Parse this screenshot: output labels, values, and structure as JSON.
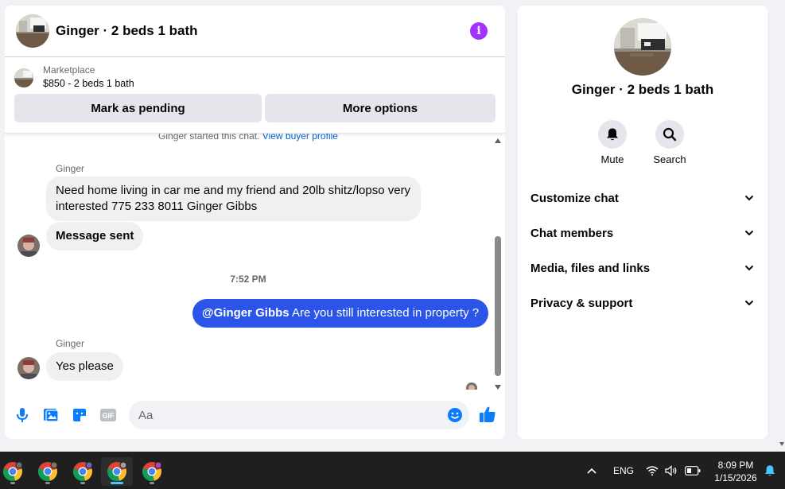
{
  "chat": {
    "title": "Ginger · 2 beds 1 bath",
    "listing": {
      "category": "Marketplace",
      "price_title": "$850 - 2 beds 1 bath",
      "mark_pending_label": "Mark as pending",
      "more_options_label": "More options"
    },
    "started_text": "Ginger started this chat.",
    "buyer_profile_link": "View buyer profile",
    "messages": [
      {
        "sender": "Ginger",
        "text": "Need home living in car me and my friend and 20lb shitz/lopso very interested 775 233  8011 Ginger Gibbs"
      },
      {
        "text": "Message sent"
      },
      {
        "timestamp": "7:52 PM"
      },
      {
        "mention": "@Ginger Gibbs",
        "text": " Are you still interested in property ?"
      },
      {
        "sender": "Ginger",
        "text": "Yes please"
      }
    ],
    "composer": {
      "placeholder": "Aa",
      "gif_label": "GIF"
    }
  },
  "info_panel": {
    "name": "Ginger · 2 beds 1 bath",
    "actions": [
      {
        "label": "Mute",
        "icon": "bell-icon"
      },
      {
        "label": "Search",
        "icon": "search-icon"
      }
    ],
    "sections": [
      {
        "label": "Customize chat"
      },
      {
        "label": "Chat members"
      },
      {
        "label": "Media, files and links"
      },
      {
        "label": "Privacy & support"
      }
    ]
  },
  "taskbar": {
    "language": "ENG",
    "time": "8:09 PM",
    "date": "1/15/2026"
  },
  "colors": {
    "accent_blue": "#2b55e8",
    "messenger_blue": "#0a7cff",
    "info_purple": "#a033ff"
  }
}
